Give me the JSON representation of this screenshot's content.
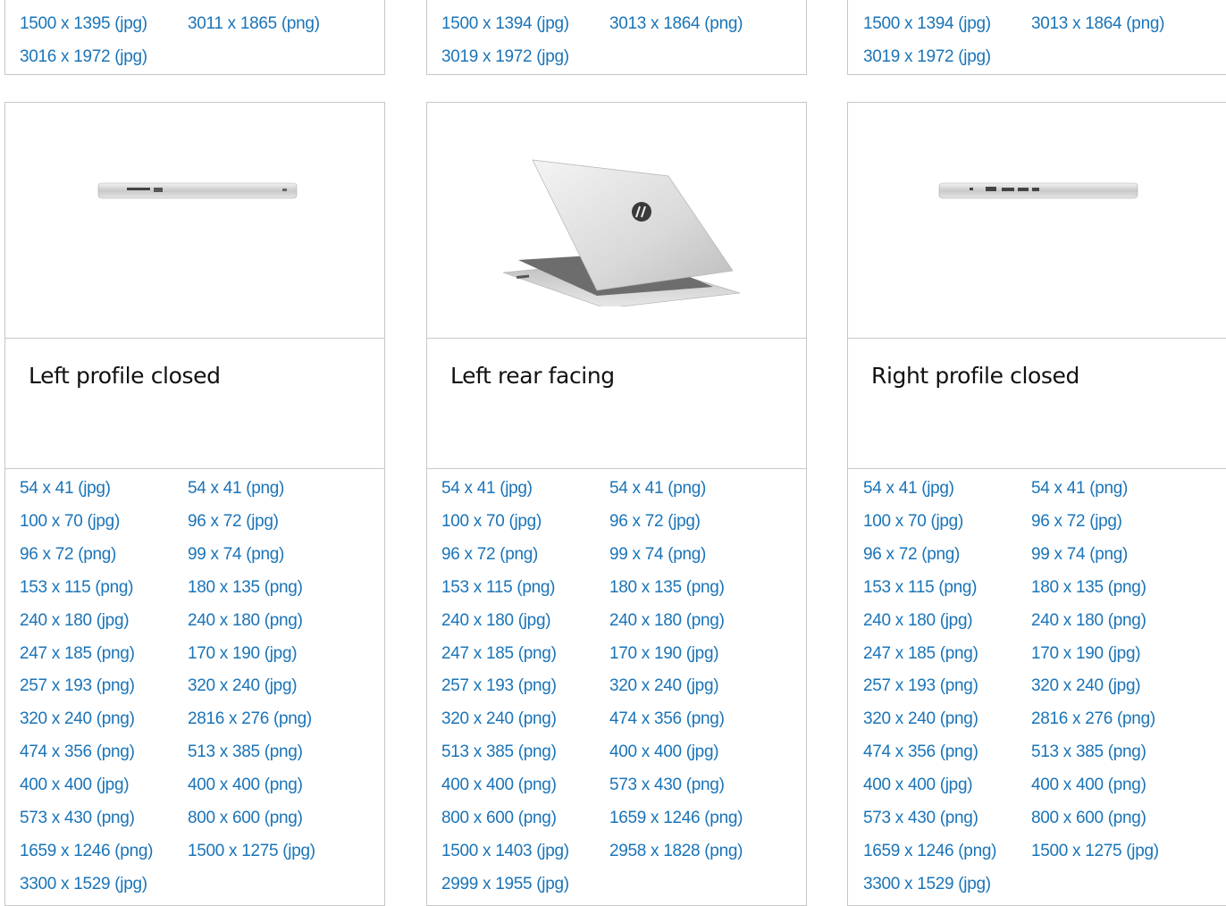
{
  "top_cards": [
    {
      "links": [
        "1500 x 1395 (jpg)",
        "3011 x 1865 (png)",
        "3016 x 1972 (jpg)"
      ]
    },
    {
      "links": [
        "1500 x 1394 (jpg)",
        "3013 x 1864 (png)",
        "3019 x 1972 (jpg)"
      ]
    },
    {
      "links": [
        "1500 x 1394 (jpg)",
        "3013 x 1864 (png)",
        "3019 x 1972 (jpg)"
      ]
    }
  ],
  "cards": [
    {
      "title": "Left profile closed",
      "image_icon": "laptop-left-profile-image",
      "links": [
        "54 x 41 (jpg)",
        "54 x 41 (png)",
        "100 x 70 (jpg)",
        "96 x 72 (jpg)",
        "96 x 72 (png)",
        "99 x 74 (png)",
        "153 x 115 (png)",
        "180 x 135 (png)",
        "240 x 180 (jpg)",
        "240 x 180 (png)",
        "247 x 185 (png)",
        "170 x 190 (jpg)",
        "257 x 193 (png)",
        "320 x 240 (jpg)",
        "320 x 240 (png)",
        "2816 x 276 (png)",
        "474 x 356 (png)",
        "513 x 385 (png)",
        "400 x 400 (jpg)",
        "400 x 400 (png)",
        "573 x 430 (png)",
        "800 x 600 (png)",
        "1659 x 1246 (png)",
        "1500 x 1275 (jpg)",
        "3300 x 1529 (jpg)"
      ]
    },
    {
      "title": "Left rear facing",
      "image_icon": "laptop-rear-image",
      "links": [
        "54 x 41 (jpg)",
        "54 x 41 (png)",
        "100 x 70 (jpg)",
        "96 x 72 (jpg)",
        "96 x 72 (png)",
        "99 x 74 (png)",
        "153 x 115 (png)",
        "180 x 135 (png)",
        "240 x 180 (jpg)",
        "240 x 180 (png)",
        "247 x 185 (png)",
        "170 x 190 (jpg)",
        "257 x 193 (png)",
        "320 x 240 (jpg)",
        "320 x 240 (png)",
        "474 x 356 (png)",
        "513 x 385 (png)",
        "400 x 400 (jpg)",
        "400 x 400 (png)",
        "573 x 430 (png)",
        "800 x 600 (png)",
        "1659 x 1246 (png)",
        "1500 x 1403 (jpg)",
        "2958 x 1828 (png)",
        "2999 x 1955 (jpg)"
      ]
    },
    {
      "title": "Right profile closed",
      "image_icon": "laptop-right-profile-image",
      "links": [
        "54 x 41 (jpg)",
        "54 x 41 (png)",
        "100 x 70 (jpg)",
        "96 x 72 (jpg)",
        "96 x 72 (png)",
        "99 x 74 (png)",
        "153 x 115 (png)",
        "180 x 135 (png)",
        "240 x 180 (jpg)",
        "240 x 180 (png)",
        "247 x 185 (png)",
        "170 x 190 (jpg)",
        "257 x 193 (png)",
        "320 x 240 (jpg)",
        "320 x 240 (png)",
        "2816 x 276 (png)",
        "474 x 356 (png)",
        "513 x 385 (png)",
        "400 x 400 (jpg)",
        "400 x 400 (png)",
        "573 x 430 (png)",
        "800 x 600 (png)",
        "1659 x 1246 (png)",
        "1500 x 1275 (jpg)",
        "3300 x 1529 (jpg)"
      ]
    }
  ],
  "colors": {
    "link": "#1a74b8",
    "border": "#c8c8c8",
    "title": "#111111"
  }
}
